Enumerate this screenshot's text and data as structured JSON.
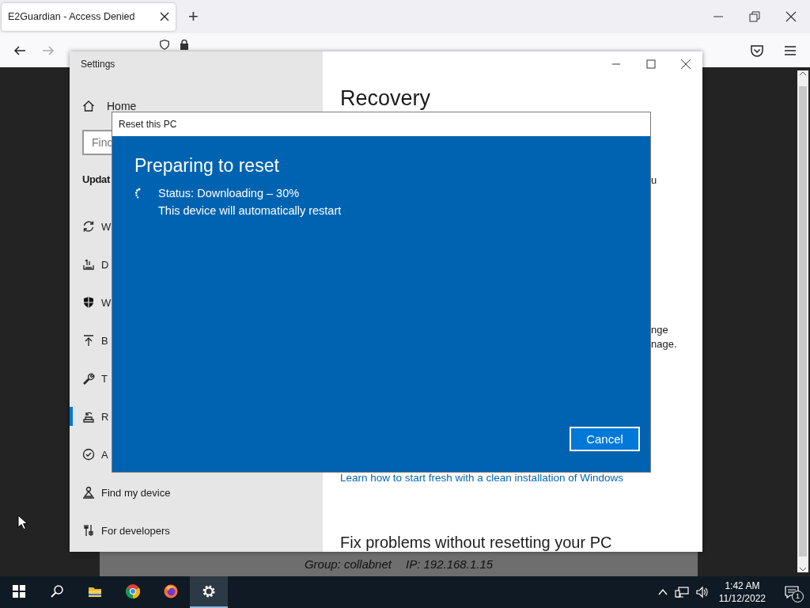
{
  "browser": {
    "tab": {
      "title": "E2Guardian - Access Denied",
      "selected": true
    },
    "new_tab": "+",
    "status_band": {
      "group": "Group: collabnet",
      "ip": "IP: 192.168.1.15"
    }
  },
  "settings": {
    "title": "Settings",
    "home": "Home",
    "search": {
      "placeholder": "Find"
    },
    "section": "Updat",
    "nav_items": [
      {
        "label": "W",
        "kind": "sync",
        "selected": false
      },
      {
        "label": "D",
        "kind": "delivery",
        "selected": false
      },
      {
        "label": "W",
        "kind": "shield",
        "selected": false
      },
      {
        "label": "B",
        "kind": "backup",
        "selected": false
      },
      {
        "label": "T",
        "kind": "wrench",
        "selected": false
      },
      {
        "label": "R",
        "kind": "recovery",
        "selected": true
      },
      {
        "label": "A",
        "kind": "check",
        "selected": false
      },
      {
        "label": "Find my device",
        "kind": "person",
        "selected": false
      },
      {
        "label": "For developers",
        "kind": "tools",
        "selected": false
      }
    ],
    "heading": "Recovery",
    "fragments": [
      "u",
      "nge",
      "nage."
    ],
    "link": "Learn how to start fresh with a clean installation of Windows",
    "subheading": "Fix problems without resetting your PC"
  },
  "dialog": {
    "title": "Reset this PC",
    "heading": "Preparing to reset",
    "status": "Status: Downloading – 30%",
    "note": "This device will automatically restart",
    "button": "Cancel"
  },
  "taskbar": {
    "apps": [
      {
        "kind": "start",
        "selected": false
      },
      {
        "kind": "search",
        "selected": false
      },
      {
        "kind": "folder",
        "selected": false
      },
      {
        "kind": "chrome",
        "selected": false
      },
      {
        "kind": "firefox",
        "selected": false
      },
      {
        "kind": "settings",
        "selected": true
      }
    ],
    "clock": {
      "time": "1:42 AM",
      "date": "11/12/2022"
    },
    "notifications": "1"
  }
}
